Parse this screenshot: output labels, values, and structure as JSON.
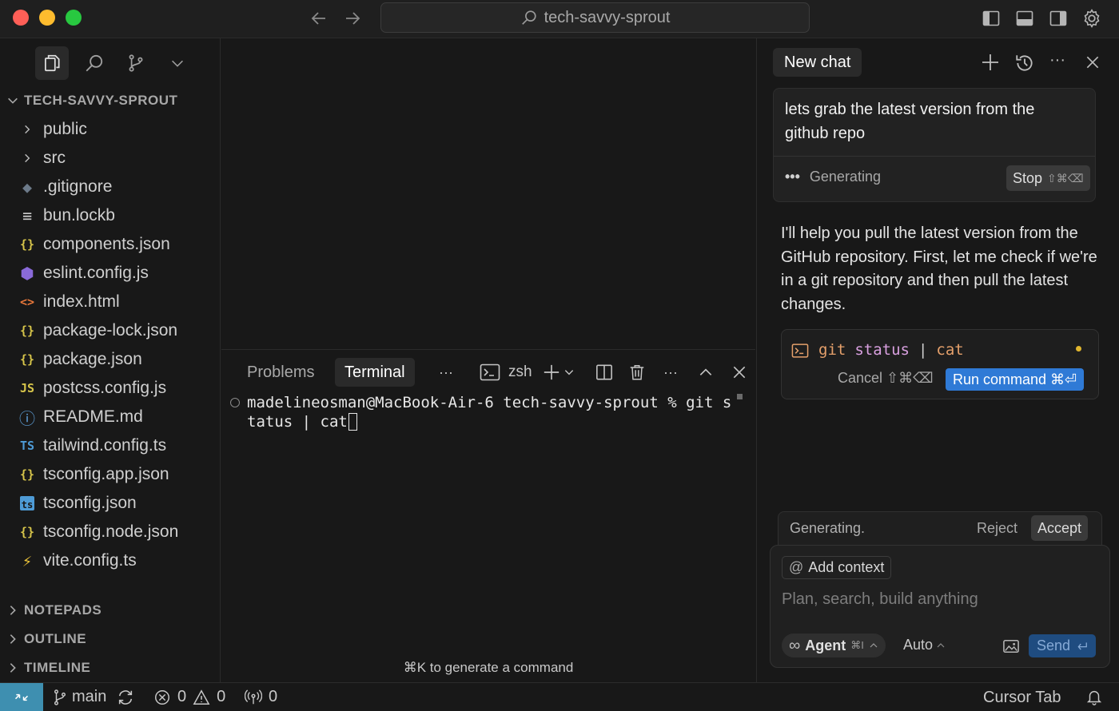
{
  "titlebar": {
    "search_text": "tech-savvy-sprout",
    "colors": {
      "close": "#ff5f57",
      "minimize": "#febc2e",
      "maximize": "#28c840"
    }
  },
  "sidebar": {
    "project_title": "TECH-SAVVY-SPROUT",
    "items": [
      {
        "label": "public",
        "icon": "chevron-right-icon",
        "type": "folder"
      },
      {
        "label": "src",
        "icon": "chevron-right-icon",
        "type": "folder"
      },
      {
        "label": ".gitignore",
        "icon": "git-icon",
        "glyph": "◆",
        "color": "#6c7a89"
      },
      {
        "label": "bun.lockb",
        "icon": "lines-icon",
        "glyph": "≡",
        "color": "#cccccc"
      },
      {
        "label": "components.json",
        "icon": "json-icon",
        "glyph": "{}",
        "color": "#d6c44a"
      },
      {
        "label": "eslint.config.js",
        "icon": "eslint-icon",
        "glyph": "⬢",
        "color": "#8a6ad9"
      },
      {
        "label": "index.html",
        "icon": "html-icon",
        "glyph": "<>",
        "color": "#e5763a"
      },
      {
        "label": "package-lock.json",
        "icon": "json-icon",
        "glyph": "{}",
        "color": "#d6c44a"
      },
      {
        "label": "package.json",
        "icon": "json-icon",
        "glyph": "{}",
        "color": "#d6c44a"
      },
      {
        "label": "postcss.config.js",
        "icon": "js-icon",
        "glyph": "JS",
        "color": "#d6c44a"
      },
      {
        "label": "README.md",
        "icon": "info-icon",
        "glyph": "ⓘ",
        "color": "#5fa2dd"
      },
      {
        "label": "tailwind.config.ts",
        "icon": "ts-icon",
        "glyph": "TS",
        "color": "#4e9bd6"
      },
      {
        "label": "tsconfig.app.json",
        "icon": "json-icon",
        "glyph": "{}",
        "color": "#d6c44a"
      },
      {
        "label": "tsconfig.json",
        "icon": "ts-box-icon",
        "glyph": "ts",
        "color": "#4e9bd6"
      },
      {
        "label": "tsconfig.node.json",
        "icon": "json-icon",
        "glyph": "{}",
        "color": "#d6c44a"
      },
      {
        "label": "vite.config.ts",
        "icon": "lightning-icon",
        "glyph": "⚡",
        "color": "#f0c73a"
      }
    ],
    "sections": [
      "NOTEPADS",
      "OUTLINE",
      "TIMELINE"
    ]
  },
  "panel": {
    "tabs": [
      "Problems",
      "Terminal"
    ],
    "active_tab": "Terminal",
    "more": "···",
    "shell": "zsh",
    "terminal_line1": "madelineosman@MacBook-Air-6 tech-savvy-sprout % git s",
    "terminal_line2": "tatus | cat",
    "hint": "⌘K to generate a command"
  },
  "chat": {
    "tab_label": "New chat",
    "user_message": "lets grab the latest version from the github repo",
    "generating_label": "Generating",
    "stop_label": "Stop",
    "stop_shortcut": "⇧⌘⌫",
    "assistant_message": "I'll help you pull the latest version from the GitHub repository. First, let me check if we're in a git repository and then pull the latest changes.",
    "command": {
      "git": "git",
      "status": "status",
      "pipe": "|",
      "cat": "cat"
    },
    "cancel_label": "Cancel ⇧⌘⌫",
    "run_label": "Run command ⌘⏎",
    "gen_status": "Generating.",
    "reject_label": "Reject",
    "accept_label": "Accept",
    "add_context": "Add context",
    "input_placeholder": "Plan, search, build anything",
    "agent_label": "Agent",
    "agent_shortcut": "⌘I",
    "auto_label": "Auto",
    "send_label": "Send"
  },
  "statusbar": {
    "branch": "main",
    "errors": "0",
    "warnings": "0",
    "broadcast": "0",
    "cursor_tab": "Cursor Tab"
  }
}
